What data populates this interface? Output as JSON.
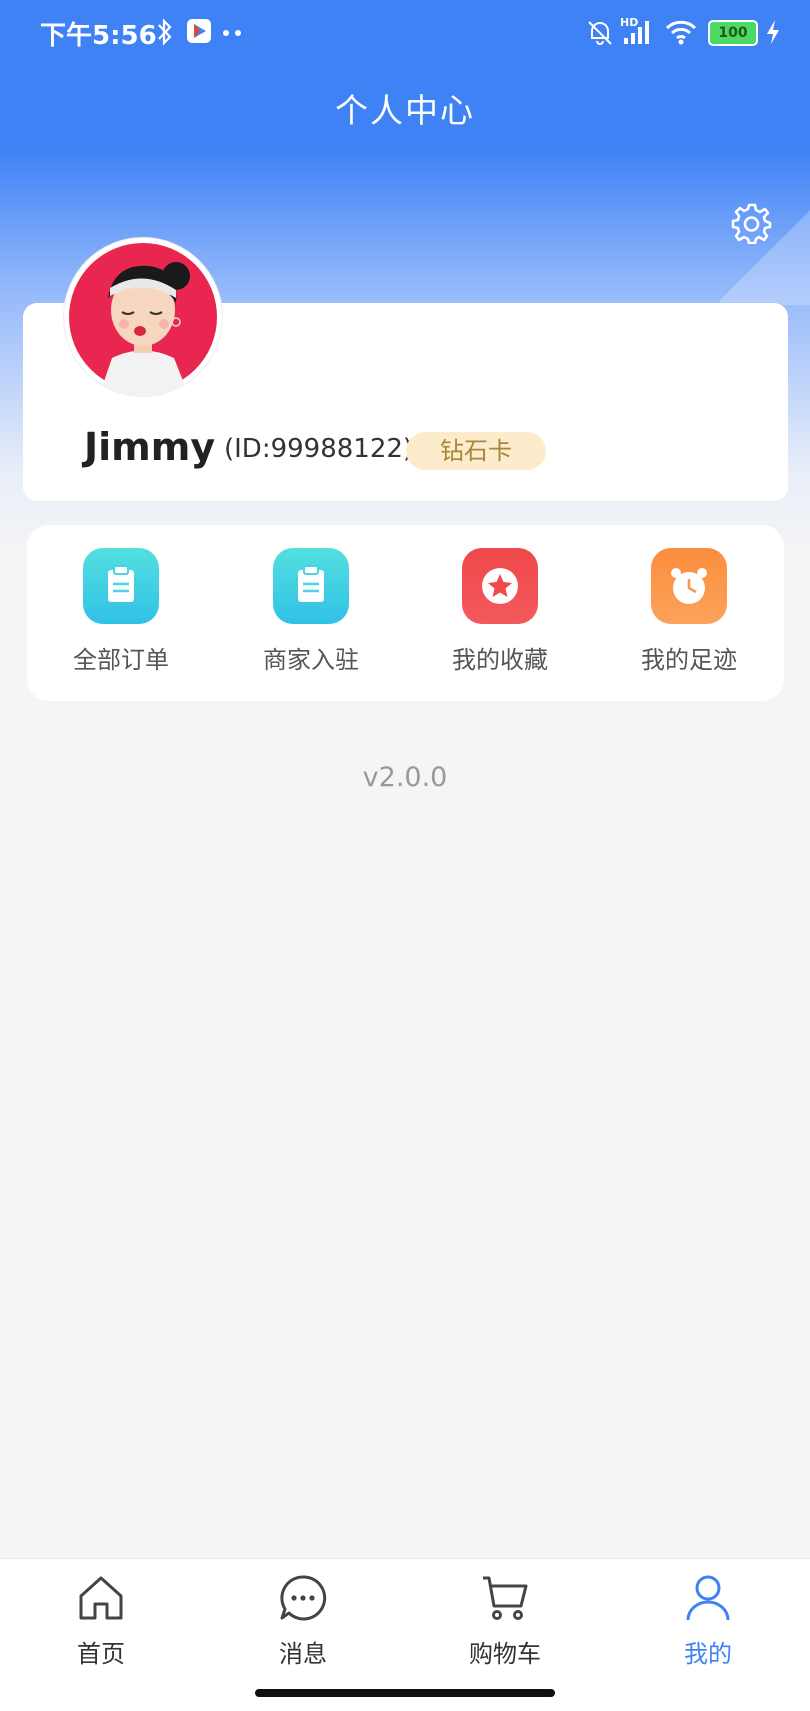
{
  "status_bar": {
    "time": "下午5:56",
    "signal_label": "HD",
    "battery": "100"
  },
  "header": {
    "title": "个人中心"
  },
  "profile": {
    "username": "Jimmy",
    "user_id": "(ID:99988122)",
    "vip_level": "钻石卡"
  },
  "menu": [
    {
      "label": "全部订单",
      "icon": "clipboard-icon",
      "color": "#3ccbd8"
    },
    {
      "label": "商家入驻",
      "icon": "clipboard-icon",
      "color": "#3ccbd8"
    },
    {
      "label": "我的收藏",
      "icon": "star-icon",
      "color": "#f0484b"
    },
    {
      "label": "我的足迹",
      "icon": "clock-icon",
      "color": "#fb9646"
    }
  ],
  "version": "v2.0.0",
  "tab_bar": {
    "tabs": [
      {
        "label": "首页",
        "icon": "home-icon"
      },
      {
        "label": "消息",
        "icon": "chat-icon"
      },
      {
        "label": "购物车",
        "icon": "cart-icon"
      },
      {
        "label": "我的",
        "icon": "user-icon"
      }
    ],
    "active_index": 3,
    "active_color": "#3f82f6"
  },
  "theme": {
    "primary": "#3f82f6",
    "background": "#f5f5f5"
  }
}
